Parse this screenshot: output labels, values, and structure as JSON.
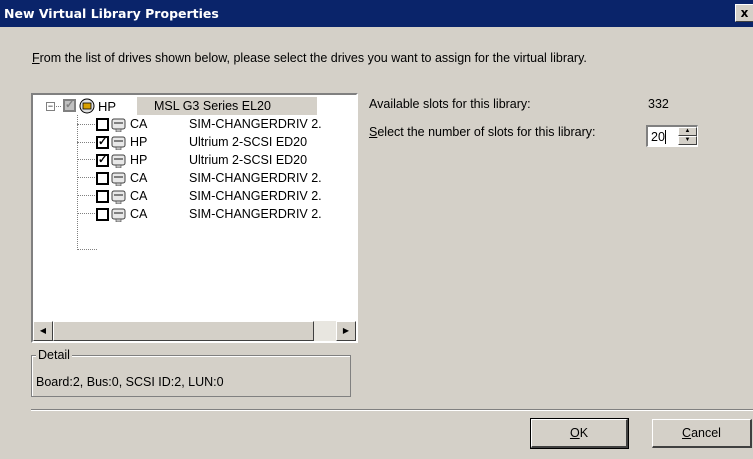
{
  "window": {
    "title": "New Virtual Library Properties",
    "close_glyph": "x"
  },
  "instruction": {
    "first_letter": "F",
    "rest": "rom the list of drives shown below, please select the drives you want to assign for the virtual library."
  },
  "tree": {
    "root": {
      "vendor": "HP",
      "model": "MSL G3 Series  EL20",
      "checked": true,
      "state": "indeterminate",
      "expander": "−"
    },
    "items": [
      {
        "vendor": "CA",
        "model": "SIM-CHANGERDRIV 2.",
        "checked": false,
        "icon": "tape-drive-icon"
      },
      {
        "vendor": "HP",
        "model": "Ultrium 2-SCSI  ED20",
        "checked": true,
        "icon": "tape-drive-icon"
      },
      {
        "vendor": "HP",
        "model": "Ultrium 2-SCSI  ED20",
        "checked": true,
        "icon": "tape-drive-icon"
      },
      {
        "vendor": "CA",
        "model": "SIM-CHANGERDRIV 2.",
        "checked": false,
        "icon": "tape-drive-icon"
      },
      {
        "vendor": "CA",
        "model": "SIM-CHANGERDRIV 2.",
        "checked": false,
        "icon": "tape-drive-icon"
      },
      {
        "vendor": "CA",
        "model": "SIM-CHANGERDRIV 2.",
        "checked": false,
        "icon": "tape-drive-icon"
      }
    ],
    "scroll_left": "◀",
    "scroll_right": "▶"
  },
  "detail": {
    "legend": "Detail",
    "value": "Board:2, Bus:0, SCSI ID:2, LUN:0"
  },
  "slots": {
    "available_label": "Available slots for this library:",
    "available_value": "332",
    "select_label_first": "S",
    "select_label_rest": "elect the number of slots for this library:",
    "select_value": "20",
    "up_glyph": "▲",
    "down_glyph": "▼"
  },
  "buttons": {
    "ok_first": "O",
    "ok_rest": "K",
    "cancel_first": "C",
    "cancel_rest": "ancel"
  },
  "checkmark": "✓",
  "colors": {
    "titlebar": "#0a246a",
    "dialog": "#d4d0c8"
  }
}
